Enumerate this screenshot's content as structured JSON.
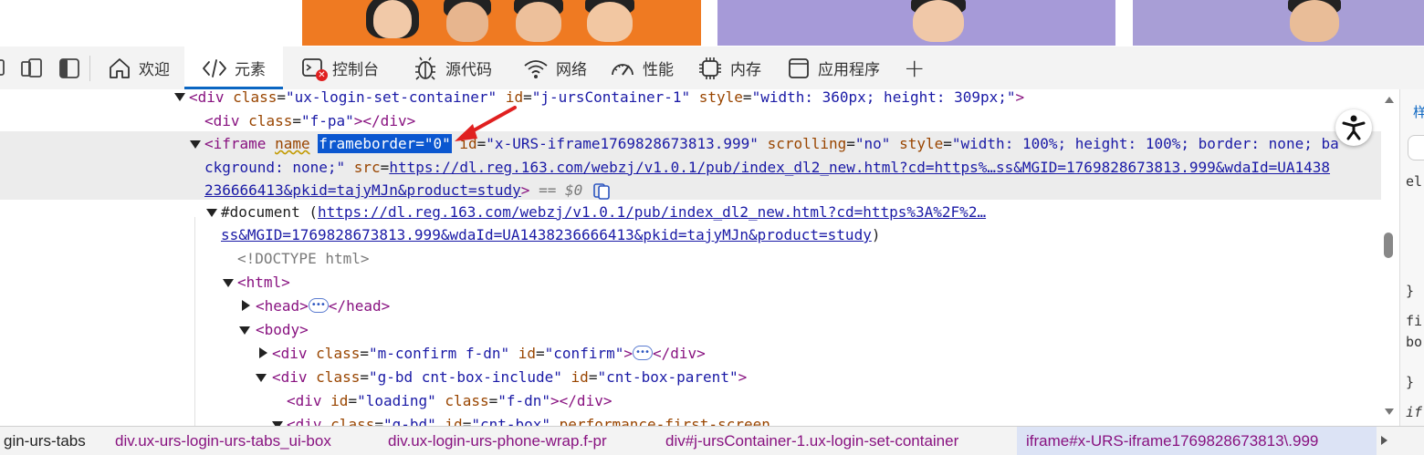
{
  "toolbar": {
    "tabs": [
      {
        "label": "欢迎",
        "icon": "home-icon"
      },
      {
        "label": "元素",
        "icon": "code-icon"
      },
      {
        "label": "控制台",
        "icon": "console-icon"
      },
      {
        "label": "源代码",
        "icon": "bug-icon"
      },
      {
        "label": "网络",
        "icon": "wifi-icon"
      },
      {
        "label": "性能",
        "icon": "gauge-icon"
      },
      {
        "label": "内存",
        "icon": "chip-icon"
      },
      {
        "label": "应用程序",
        "icon": "app-icon"
      }
    ],
    "add_tab": "+",
    "active_tab": "元素",
    "accent_color": "#0b66c2",
    "error_badge_color": "#e02020"
  },
  "dom": {
    "l1": {
      "open": "<div",
      "a1": "class",
      "v1": "\"ux-login-set-container\"",
      "a2": "id",
      "v2": "\"j-ursContainer-1\"",
      "a3": "style",
      "v3": "\"width: 360px; height: 309px;\"",
      "close": ">"
    },
    "l2": {
      "open": "<div",
      "a1": "class",
      "v1": "\"f-pa\"",
      "close": "></div>"
    },
    "l3": {
      "open": "<iframe",
      "a1": "name",
      "highlight": "frameborder=\"0\"",
      "a2": "id",
      "v2": "\"x-URS-iframe1769828673813.999\"",
      "a3": "scrolling",
      "v3": "\"no\"",
      "a4": "style",
      "v4": "\"width: 100%; height: 100%; border: none; ba"
    },
    "l4": {
      "text": "ckground: none;\"",
      "a1": "src",
      "url": "https://dl.reg.163.com/webzj/v1.0.1/pub/index_dl2_new.html?cd=https%…ss&MGID=1769828673813.999&wdaId=UA1438"
    },
    "l5": {
      "url": "236666413&pkid=tajyMJn&product=study",
      "close": ">",
      "eq": "== $0"
    },
    "l6": {
      "label": "#document",
      "open": "(",
      "url": "https://dl.reg.163.com/webzj/v1.0.1/pub/index_dl2_new.html?cd=https%3A%2F%2…"
    },
    "l7": {
      "url": "ss&MGID=1769828673813.999&wdaId=UA1438236666413&pkid=tajyMJn&product=study",
      "close": ")"
    },
    "l8": {
      "text": "<!DOCTYPE html>"
    },
    "l9": {
      "text": "<html>"
    },
    "l10": {
      "open": "<head>",
      "close": "</head>"
    },
    "l11": {
      "text": "<body>"
    },
    "l12": {
      "open": "<div",
      "a1": "class",
      "v1": "\"m-confirm f-dn\"",
      "a2": "id",
      "v2": "\"confirm\"",
      "mid": ">",
      "close": "</div>"
    },
    "l13": {
      "open": "<div",
      "a1": "class",
      "v1": "\"g-bd cnt-box-include\"",
      "a2": "id",
      "v2": "\"cnt-box-parent\"",
      "close": ">"
    },
    "l14": {
      "open": "<div",
      "a1": "id",
      "v1": "\"loading\"",
      "a2": "class",
      "v2": "\"f-dn\"",
      "close": "></div>"
    },
    "l15": {
      "open": "<div",
      "a1": "class",
      "v1": "\"g-bd\"",
      "a2": "id",
      "v2": "\"cnt-box\"",
      "a3": "performance-first-screen"
    }
  },
  "right_panel": {
    "t1": "样",
    "t2": "el",
    "t3": "}",
    "t4": "fi",
    "t5": "bo",
    "t6": "}",
    "t7": "if"
  },
  "breadcrumbs": [
    "gin-urs-tabs",
    "div.ux-urs-login-urs-tabs_ui-box",
    "div.ux-login-urs-phone-wrap.f-pr",
    "div#j-ursContainer-1.ux-login-set-container",
    "iframe#x-URS-iframe1769828673813\\.999"
  ]
}
